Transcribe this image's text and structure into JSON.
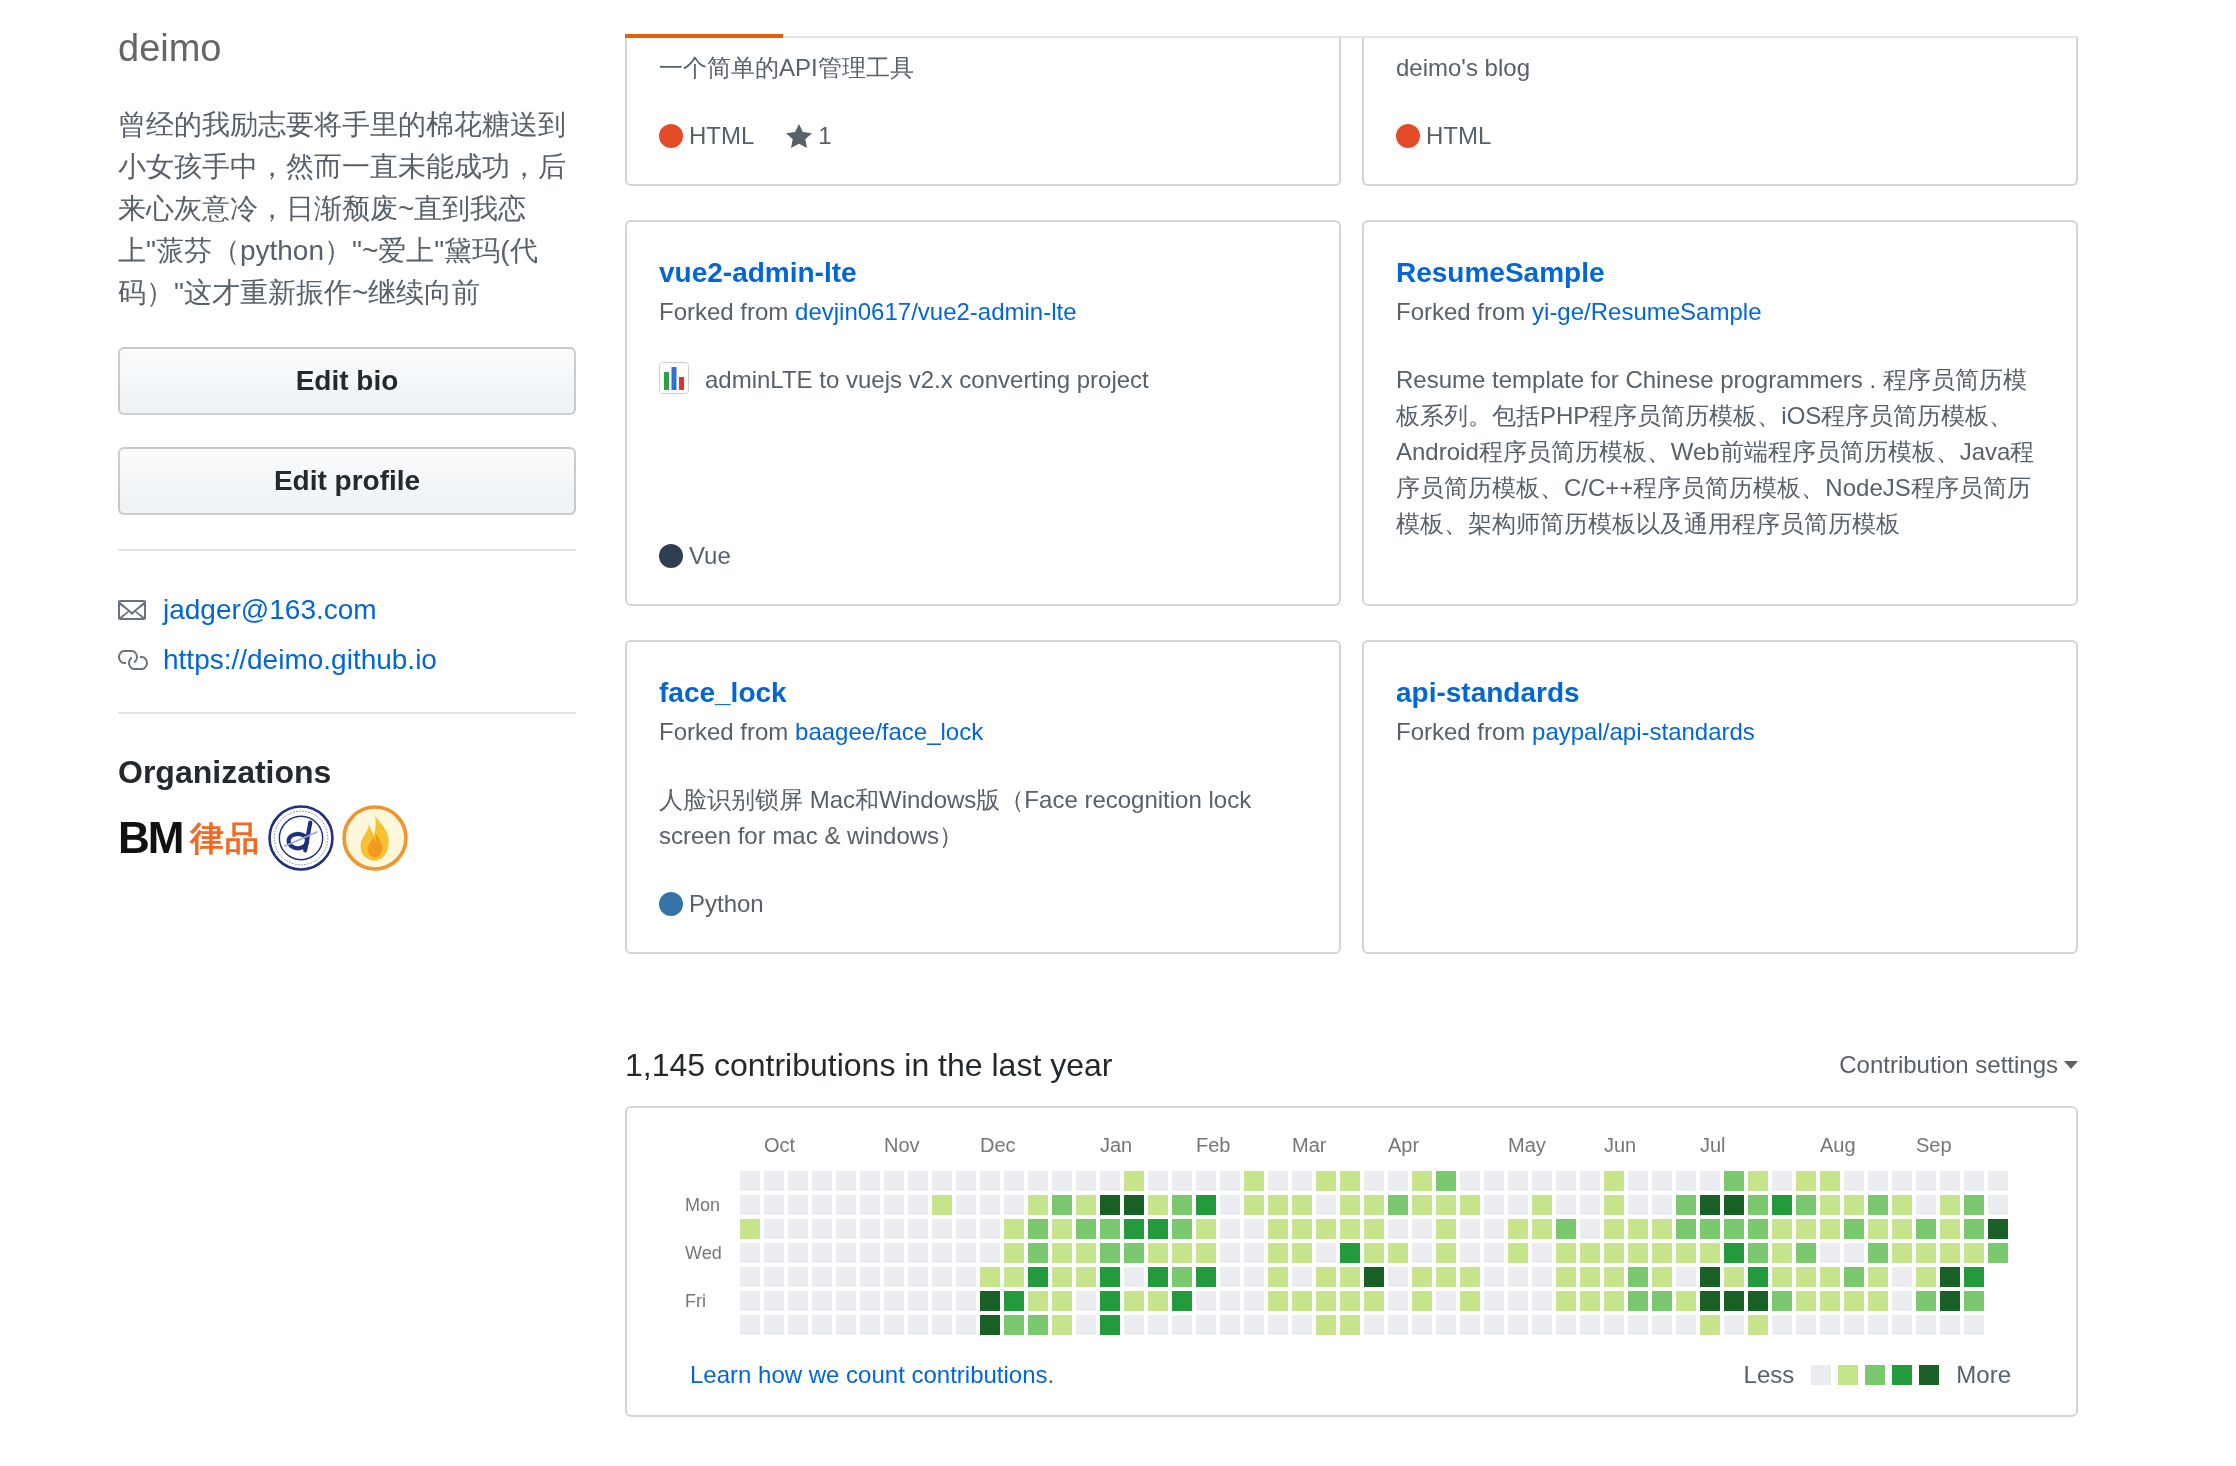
{
  "profile": {
    "username": "deimo",
    "bio": "曾经的我励志要将手里的棉花糖送到小女孩手中，然而一直未能成功，后来心灰意冷，日渐颓废~直到我恋上\"蒎芬（python）\"~爱上\"黛玛(代码）\"这才重新振作~继续向前",
    "buttons": [
      "Edit bio",
      "Edit profile"
    ],
    "email": "jadger@163.com",
    "website": "https://deimo.github.io",
    "organizations_title": "Organizations",
    "organizations": [
      {
        "kind": "wordmark",
        "text": "BM",
        "color": "#111111"
      },
      {
        "kind": "wordmark",
        "text": "律品",
        "color": "#f26a21"
      },
      {
        "kind": "seal",
        "color": "#1f2f7a"
      },
      {
        "kind": "flame",
        "color": "#f0962e"
      }
    ]
  },
  "pinned": [
    {
      "kind": "cut_off",
      "description": "一个简单的API管理工具",
      "emoji": false,
      "language": {
        "name": "HTML",
        "color": "#e34c26"
      },
      "star_count": "1"
    },
    {
      "kind": "cut_off",
      "description": "deimo's blog",
      "emoji": false,
      "language": {
        "name": "HTML",
        "color": "#e34c26"
      }
    },
    {
      "kind": "full",
      "name": "vue2-admin-lte",
      "fork": {
        "label": "Forked from",
        "source": "devjin0617/vue2-admin-lte"
      },
      "emoji": true,
      "description": "adminLTE to vuejs v2.x converting project",
      "language": {
        "name": "Vue",
        "color": "#2c3e50"
      }
    },
    {
      "kind": "full",
      "name": "ResumeSample",
      "fork": {
        "label": "Forked from",
        "source": "yi-ge/ResumeSample"
      },
      "emoji": false,
      "description": "Resume template for Chinese programmers . 程序员简历模板系列。包括PHP程序员简历模板、iOS程序员简历模板、Android程序员简历模板、Web前端程序员简历模板、Java程序员简历模板、C/C++程序员简历模板、NodeJS程序员简历模板、架构师简历模板以及通用程序员简历模板"
    },
    {
      "kind": "full",
      "name": "face_lock",
      "fork": {
        "label": "Forked from",
        "source": "baagee/face_lock"
      },
      "emoji": false,
      "description": "人脸识别锁屏 Mac和Windows版（Face recognition lock screen for mac & windows）",
      "language": {
        "name": "Python",
        "color": "#3572a5"
      }
    },
    {
      "kind": "full",
      "name": "api-standards",
      "fork": {
        "label": "Forked from",
        "source": "paypal/api-standards"
      },
      "emoji": false
    }
  ],
  "contributions": {
    "title": "1,145 contributions in the last year",
    "settings": "Contribution settings",
    "day_labels": [
      "Mon",
      "Wed",
      "Fri"
    ],
    "weeks": [
      {
        "days": [
          {
            "color": "#ebedf0"
          },
          {
            "color": "#ebedf0"
          },
          {
            "color": "#c6e48b"
          },
          {
            "color": "#ebedf0"
          },
          {
            "color": "#ebedf0"
          },
          {
            "color": "#ebedf0"
          },
          {
            "color": "#ebedf0"
          }
        ]
      },
      {
        "month": "Oct",
        "days": [
          {
            "color": "#ebedf0"
          },
          {
            "color": "#ebedf0"
          },
          {
            "color": "#ebedf0"
          },
          {
            "color": "#ebedf0"
          },
          {
            "color": "#ebedf0"
          },
          {
            "color": "#ebedf0"
          },
          {
            "color": "#ebedf0"
          }
        ]
      },
      {
        "days": [
          {
            "color": "#ebedf0"
          },
          {
            "color": "#ebedf0"
          },
          {
            "color": "#ebedf0"
          },
          {
            "color": "#ebedf0"
          },
          {
            "color": "#ebedf0"
          },
          {
            "color": "#ebedf0"
          },
          {
            "color": "#ebedf0"
          }
        ]
      },
      {
        "days": [
          {
            "color": "#ebedf0"
          },
          {
            "color": "#ebedf0"
          },
          {
            "color": "#ebedf0"
          },
          {
            "color": "#ebedf0"
          },
          {
            "color": "#ebedf0"
          },
          {
            "color": "#ebedf0"
          },
          {
            "color": "#ebedf0"
          }
        ]
      },
      {
        "days": [
          {
            "color": "#ebedf0"
          },
          {
            "color": "#ebedf0"
          },
          {
            "color": "#ebedf0"
          },
          {
            "color": "#ebedf0"
          },
          {
            "color": "#ebedf0"
          },
          {
            "color": "#ebedf0"
          },
          {
            "color": "#ebedf0"
          }
        ]
      },
      {
        "days": [
          {
            "color": "#ebedf0"
          },
          {
            "color": "#ebedf0"
          },
          {
            "color": "#ebedf0"
          },
          {
            "color": "#ebedf0"
          },
          {
            "color": "#ebedf0"
          },
          {
            "color": "#ebedf0"
          },
          {
            "color": "#ebedf0"
          }
        ]
      },
      {
        "month": "Nov",
        "days": [
          {
            "color": "#ebedf0"
          },
          {
            "color": "#ebedf0"
          },
          {
            "color": "#ebedf0"
          },
          {
            "color": "#ebedf0"
          },
          {
            "color": "#ebedf0"
          },
          {
            "color": "#ebedf0"
          },
          {
            "color": "#ebedf0"
          }
        ]
      },
      {
        "days": [
          {
            "color": "#ebedf0"
          },
          {
            "color": "#ebedf0"
          },
          {
            "color": "#ebedf0"
          },
          {
            "color": "#ebedf0"
          },
          {
            "color": "#ebedf0"
          },
          {
            "color": "#ebedf0"
          },
          {
            "color": "#ebedf0"
          }
        ]
      },
      {
        "days": [
          {
            "color": "#ebedf0"
          },
          {
            "color": "#c6e48b"
          },
          {
            "color": "#ebedf0"
          },
          {
            "color": "#ebedf0"
          },
          {
            "color": "#ebedf0"
          },
          {
            "color": "#ebedf0"
          },
          {
            "color": "#ebedf0"
          }
        ]
      },
      {
        "days": [
          {
            "color": "#ebedf0"
          },
          {
            "color": "#ebedf0"
          },
          {
            "color": "#ebedf0"
          },
          {
            "color": "#ebedf0"
          },
          {
            "color": "#ebedf0"
          },
          {
            "color": "#ebedf0"
          },
          {
            "color": "#ebedf0"
          }
        ]
      },
      {
        "month": "Dec",
        "days": [
          {
            "color": "#ebedf0"
          },
          {
            "color": "#ebedf0"
          },
          {
            "color": "#ebedf0"
          },
          {
            "color": "#ebedf0"
          },
          {
            "color": "#c6e48b"
          },
          {
            "color": "#196127"
          },
          {
            "color": "#196127"
          }
        ]
      },
      {
        "days": [
          {
            "color": "#ebedf0"
          },
          {
            "color": "#ebedf0"
          },
          {
            "color": "#c6e48b"
          },
          {
            "color": "#c6e48b"
          },
          {
            "color": "#c6e48b"
          },
          {
            "color": "#239a3b"
          },
          {
            "color": "#7bc96f"
          }
        ]
      },
      {
        "days": [
          {
            "color": "#ebedf0"
          },
          {
            "color": "#c6e48b"
          },
          {
            "color": "#7bc96f"
          },
          {
            "color": "#7bc96f"
          },
          {
            "color": "#239a3b"
          },
          {
            "color": "#c6e48b"
          },
          {
            "color": "#7bc96f"
          }
        ]
      },
      {
        "days": [
          {
            "color": "#ebedf0"
          },
          {
            "color": "#7bc96f"
          },
          {
            "color": "#c6e48b"
          },
          {
            "color": "#c6e48b"
          },
          {
            "color": "#c6e48b"
          },
          {
            "color": "#c6e48b"
          },
          {
            "color": "#c6e48b"
          }
        ]
      },
      {
        "days": [
          {
            "color": "#ebedf0"
          },
          {
            "color": "#c6e48b"
          },
          {
            "color": "#7bc96f"
          },
          {
            "color": "#c6e48b"
          },
          {
            "color": "#c6e48b"
          },
          {
            "color": "#ebedf0"
          },
          {
            "color": "#ebedf0"
          }
        ]
      },
      {
        "month": "Jan",
        "days": [
          {
            "color": "#ebedf0"
          },
          {
            "color": "#196127"
          },
          {
            "color": "#7bc96f"
          },
          {
            "color": "#7bc96f"
          },
          {
            "color": "#239a3b"
          },
          {
            "color": "#239a3b"
          },
          {
            "color": "#239a3b"
          }
        ]
      },
      {
        "days": [
          {
            "color": "#c6e48b"
          },
          {
            "color": "#196127"
          },
          {
            "color": "#239a3b"
          },
          {
            "color": "#7bc96f"
          },
          {
            "color": "#ebedf0"
          },
          {
            "color": "#c6e48b"
          },
          {
            "color": "#ebedf0"
          }
        ]
      },
      {
        "days": [
          {
            "color": "#ebedf0"
          },
          {
            "color": "#c6e48b"
          },
          {
            "color": "#239a3b"
          },
          {
            "color": "#c6e48b"
          },
          {
            "color": "#239a3b"
          },
          {
            "color": "#c6e48b"
          },
          {
            "color": "#ebedf0"
          }
        ]
      },
      {
        "days": [
          {
            "color": "#ebedf0"
          },
          {
            "color": "#7bc96f"
          },
          {
            "color": "#7bc96f"
          },
          {
            "color": "#c6e48b"
          },
          {
            "color": "#7bc96f"
          },
          {
            "color": "#239a3b"
          },
          {
            "color": "#ebedf0"
          }
        ]
      },
      {
        "month": "Feb",
        "days": [
          {
            "color": "#ebedf0"
          },
          {
            "color": "#239a3b"
          },
          {
            "color": "#c6e48b"
          },
          {
            "color": "#c6e48b"
          },
          {
            "color": "#239a3b"
          },
          {
            "color": "#ebedf0"
          },
          {
            "color": "#ebedf0"
          }
        ]
      },
      {
        "days": [
          {
            "color": "#ebedf0"
          },
          {
            "color": "#ebedf0"
          },
          {
            "color": "#ebedf0"
          },
          {
            "color": "#ebedf0"
          },
          {
            "color": "#ebedf0"
          },
          {
            "color": "#ebedf0"
          },
          {
            "color": "#ebedf0"
          }
        ]
      },
      {
        "days": [
          {
            "color": "#c6e48b"
          },
          {
            "color": "#c6e48b"
          },
          {
            "color": "#ebedf0"
          },
          {
            "color": "#ebedf0"
          },
          {
            "color": "#ebedf0"
          },
          {
            "color": "#ebedf0"
          },
          {
            "color": "#ebedf0"
          }
        ]
      },
      {
        "days": [
          {
            "color": "#ebedf0"
          },
          {
            "color": "#c6e48b"
          },
          {
            "color": "#c6e48b"
          },
          {
            "color": "#c6e48b"
          },
          {
            "color": "#c6e48b"
          },
          {
            "color": "#c6e48b"
          },
          {
            "color": "#ebedf0"
          }
        ]
      },
      {
        "month": "Mar",
        "days": [
          {
            "color": "#ebedf0"
          },
          {
            "color": "#c6e48b"
          },
          {
            "color": "#c6e48b"
          },
          {
            "color": "#c6e48b"
          },
          {
            "color": "#ebedf0"
          },
          {
            "color": "#c6e48b"
          },
          {
            "color": "#ebedf0"
          }
        ]
      },
      {
        "days": [
          {
            "color": "#c6e48b"
          },
          {
            "color": "#ebedf0"
          },
          {
            "color": "#c6e48b"
          },
          {
            "color": "#ebedf0"
          },
          {
            "color": "#c6e48b"
          },
          {
            "color": "#c6e48b"
          },
          {
            "color": "#c6e48b"
          }
        ]
      },
      {
        "days": [
          {
            "color": "#c6e48b"
          },
          {
            "color": "#c6e48b"
          },
          {
            "color": "#c6e48b"
          },
          {
            "color": "#239a3b"
          },
          {
            "color": "#c6e48b"
          },
          {
            "color": "#c6e48b"
          },
          {
            "color": "#c6e48b"
          }
        ]
      },
      {
        "days": [
          {
            "color": "#ebedf0"
          },
          {
            "color": "#c6e48b"
          },
          {
            "color": "#c6e48b"
          },
          {
            "color": "#c6e48b"
          },
          {
            "color": "#196127"
          },
          {
            "color": "#c6e48b"
          },
          {
            "color": "#ebedf0"
          }
        ]
      },
      {
        "month": "Apr",
        "days": [
          {
            "color": "#ebedf0"
          },
          {
            "color": "#7bc96f"
          },
          {
            "color": "#ebedf0"
          },
          {
            "color": "#c6e48b"
          },
          {
            "color": "#ebedf0"
          },
          {
            "color": "#ebedf0"
          },
          {
            "color": "#ebedf0"
          }
        ]
      },
      {
        "days": [
          {
            "color": "#c6e48b"
          },
          {
            "color": "#c6e48b"
          },
          {
            "color": "#ebedf0"
          },
          {
            "color": "#ebedf0"
          },
          {
            "color": "#c6e48b"
          },
          {
            "color": "#c6e48b"
          },
          {
            "color": "#ebedf0"
          }
        ]
      },
      {
        "days": [
          {
            "color": "#7bc96f"
          },
          {
            "color": "#c6e48b"
          },
          {
            "color": "#c6e48b"
          },
          {
            "color": "#c6e48b"
          },
          {
            "color": "#c6e48b"
          },
          {
            "color": "#ebedf0"
          },
          {
            "color": "#ebedf0"
          }
        ]
      },
      {
        "days": [
          {
            "color": "#ebedf0"
          },
          {
            "color": "#c6e48b"
          },
          {
            "color": "#ebedf0"
          },
          {
            "color": "#ebedf0"
          },
          {
            "color": "#c6e48b"
          },
          {
            "color": "#c6e48b"
          },
          {
            "color": "#ebedf0"
          }
        ]
      },
      {
        "days": [
          {
            "color": "#ebedf0"
          },
          {
            "color": "#ebedf0"
          },
          {
            "color": "#ebedf0"
          },
          {
            "color": "#ebedf0"
          },
          {
            "color": "#ebedf0"
          },
          {
            "color": "#ebedf0"
          },
          {
            "color": "#ebedf0"
          }
        ]
      },
      {
        "month": "May",
        "days": [
          {
            "color": "#ebedf0"
          },
          {
            "color": "#ebedf0"
          },
          {
            "color": "#c6e48b"
          },
          {
            "color": "#c6e48b"
          },
          {
            "color": "#ebedf0"
          },
          {
            "color": "#ebedf0"
          },
          {
            "color": "#ebedf0"
          }
        ]
      },
      {
        "days": [
          {
            "color": "#ebedf0"
          },
          {
            "color": "#c6e48b"
          },
          {
            "color": "#c6e48b"
          },
          {
            "color": "#ebedf0"
          },
          {
            "color": "#ebedf0"
          },
          {
            "color": "#ebedf0"
          },
          {
            "color": "#ebedf0"
          }
        ]
      },
      {
        "days": [
          {
            "color": "#ebedf0"
          },
          {
            "color": "#ebedf0"
          },
          {
            "color": "#7bc96f"
          },
          {
            "color": "#c6e48b"
          },
          {
            "color": "#c6e48b"
          },
          {
            "color": "#c6e48b"
          },
          {
            "color": "#ebedf0"
          }
        ]
      },
      {
        "days": [
          {
            "color": "#ebedf0"
          },
          {
            "color": "#ebedf0"
          },
          {
            "color": "#ebedf0"
          },
          {
            "color": "#c6e48b"
          },
          {
            "color": "#c6e48b"
          },
          {
            "color": "#c6e48b"
          },
          {
            "color": "#ebedf0"
          }
        ]
      },
      {
        "month": "Jun",
        "days": [
          {
            "color": "#c6e48b"
          },
          {
            "color": "#c6e48b"
          },
          {
            "color": "#c6e48b"
          },
          {
            "color": "#c6e48b"
          },
          {
            "color": "#c6e48b"
          },
          {
            "color": "#c6e48b"
          },
          {
            "color": "#ebedf0"
          }
        ]
      },
      {
        "days": [
          {
            "color": "#ebedf0"
          },
          {
            "color": "#ebedf0"
          },
          {
            "color": "#c6e48b"
          },
          {
            "color": "#c6e48b"
          },
          {
            "color": "#7bc96f"
          },
          {
            "color": "#7bc96f"
          },
          {
            "color": "#ebedf0"
          }
        ]
      },
      {
        "days": [
          {
            "color": "#ebedf0"
          },
          {
            "color": "#ebedf0"
          },
          {
            "color": "#c6e48b"
          },
          {
            "color": "#c6e48b"
          },
          {
            "color": "#c6e48b"
          },
          {
            "color": "#7bc96f"
          },
          {
            "color": "#ebedf0"
          }
        ]
      },
      {
        "days": [
          {
            "color": "#ebedf0"
          },
          {
            "color": "#7bc96f"
          },
          {
            "color": "#7bc96f"
          },
          {
            "color": "#c6e48b"
          },
          {
            "color": "#ebedf0"
          },
          {
            "color": "#c6e48b"
          },
          {
            "color": "#ebedf0"
          }
        ]
      },
      {
        "month": "Jul",
        "days": [
          {
            "color": "#ebedf0"
          },
          {
            "color": "#196127"
          },
          {
            "color": "#7bc96f"
          },
          {
            "color": "#c6e48b"
          },
          {
            "color": "#196127"
          },
          {
            "color": "#196127"
          },
          {
            "color": "#c6e48b"
          }
        ]
      },
      {
        "days": [
          {
            "color": "#7bc96f"
          },
          {
            "color": "#196127"
          },
          {
            "color": "#7bc96f"
          },
          {
            "color": "#239a3b"
          },
          {
            "color": "#c6e48b"
          },
          {
            "color": "#196127"
          },
          {
            "color": "#ebedf0"
          }
        ]
      },
      {
        "days": [
          {
            "color": "#c6e48b"
          },
          {
            "color": "#7bc96f"
          },
          {
            "color": "#7bc96f"
          },
          {
            "color": "#7bc96f"
          },
          {
            "color": "#239a3b"
          },
          {
            "color": "#196127"
          },
          {
            "color": "#c6e48b"
          }
        ]
      },
      {
        "days": [
          {
            "color": "#ebedf0"
          },
          {
            "color": "#239a3b"
          },
          {
            "color": "#c6e48b"
          },
          {
            "color": "#c6e48b"
          },
          {
            "color": "#c6e48b"
          },
          {
            "color": "#7bc96f"
          },
          {
            "color": "#ebedf0"
          }
        ]
      },
      {
        "days": [
          {
            "color": "#c6e48b"
          },
          {
            "color": "#7bc96f"
          },
          {
            "color": "#c6e48b"
          },
          {
            "color": "#7bc96f"
          },
          {
            "color": "#c6e48b"
          },
          {
            "color": "#c6e48b"
          },
          {
            "color": "#ebedf0"
          }
        ]
      },
      {
        "month": "Aug",
        "days": [
          {
            "color": "#c6e48b"
          },
          {
            "color": "#c6e48b"
          },
          {
            "color": "#c6e48b"
          },
          {
            "color": "#ebedf0"
          },
          {
            "color": "#c6e48b"
          },
          {
            "color": "#c6e48b"
          },
          {
            "color": "#ebedf0"
          }
        ]
      },
      {
        "days": [
          {
            "color": "#ebedf0"
          },
          {
            "color": "#c6e48b"
          },
          {
            "color": "#7bc96f"
          },
          {
            "color": "#ebedf0"
          },
          {
            "color": "#7bc96f"
          },
          {
            "color": "#c6e48b"
          },
          {
            "color": "#ebedf0"
          }
        ]
      },
      {
        "days": [
          {
            "color": "#ebedf0"
          },
          {
            "color": "#7bc96f"
          },
          {
            "color": "#c6e48b"
          },
          {
            "color": "#7bc96f"
          },
          {
            "color": "#c6e48b"
          },
          {
            "color": "#c6e48b"
          },
          {
            "color": "#ebedf0"
          }
        ]
      },
      {
        "days": [
          {
            "color": "#ebedf0"
          },
          {
            "color": "#c6e48b"
          },
          {
            "color": "#c6e48b"
          },
          {
            "color": "#c6e48b"
          },
          {
            "color": "#ebedf0"
          },
          {
            "color": "#ebedf0"
          },
          {
            "color": "#ebedf0"
          }
        ]
      },
      {
        "month": "Sep",
        "days": [
          {
            "color": "#ebedf0"
          },
          {
            "color": "#ebedf0"
          },
          {
            "color": "#7bc96f"
          },
          {
            "color": "#c6e48b"
          },
          {
            "color": "#c6e48b"
          },
          {
            "color": "#7bc96f"
          },
          {
            "color": "#ebedf0"
          }
        ]
      },
      {
        "days": [
          {
            "color": "#ebedf0"
          },
          {
            "color": "#c6e48b"
          },
          {
            "color": "#c6e48b"
          },
          {
            "color": "#c6e48b"
          },
          {
            "color": "#196127"
          },
          {
            "color": "#196127"
          },
          {
            "color": "#ebedf0"
          }
        ]
      },
      {
        "days": [
          {
            "color": "#ebedf0"
          },
          {
            "color": "#7bc96f"
          },
          {
            "color": "#7bc96f"
          },
          {
            "color": "#c6e48b"
          },
          {
            "color": "#239a3b"
          },
          {
            "color": "#7bc96f"
          },
          {
            "color": "#ebedf0"
          }
        ]
      },
      {
        "days": [
          {
            "color": "#ebedf0"
          },
          {
            "color": "#ebedf0"
          },
          {
            "color": "#196127"
          },
          {
            "color": "#7bc96f"
          }
        ]
      }
    ],
    "help": {
      "link": "Learn how we count contributions",
      "after": "."
    },
    "legend": {
      "less": "Less",
      "more": "More",
      "swatches": [
        {
          "color": "#ebedf0"
        },
        {
          "color": "#c6e48b"
        },
        {
          "color": "#7bc96f"
        },
        {
          "color": "#239a3b"
        },
        {
          "color": "#196127"
        }
      ]
    }
  }
}
